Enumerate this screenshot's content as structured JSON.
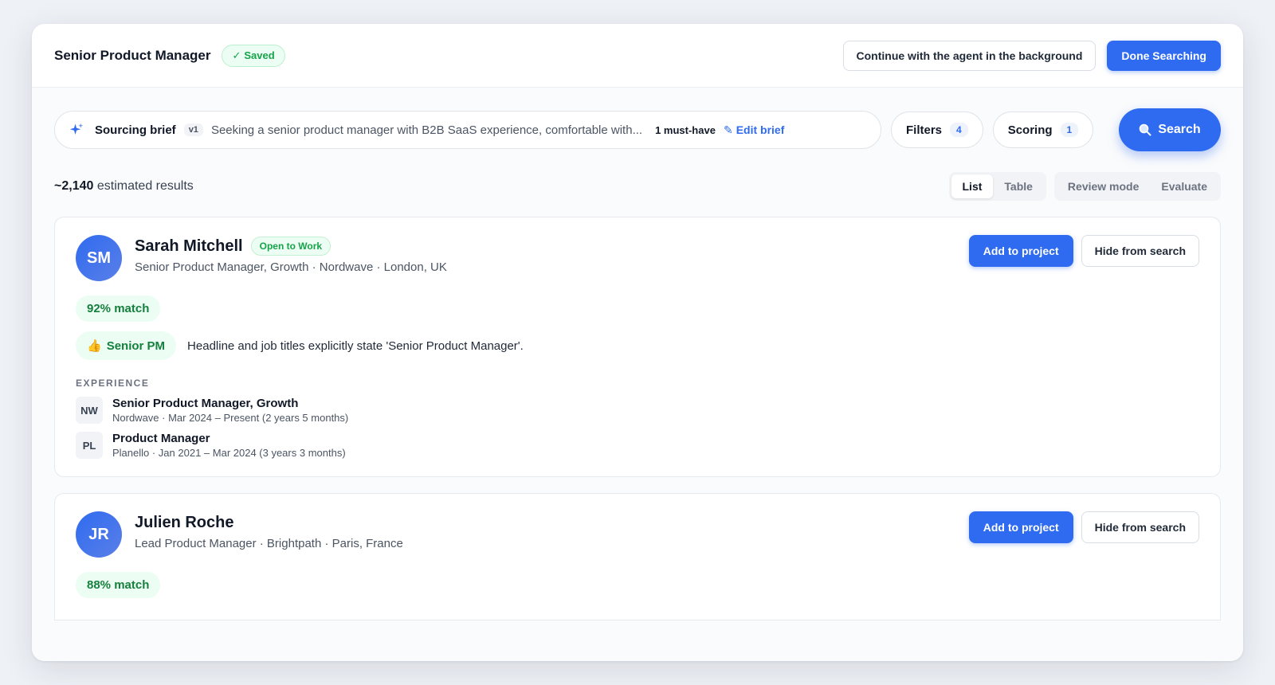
{
  "header": {
    "title": "Senior Product Manager",
    "saved_badge": "Saved",
    "continue_button": "Continue with the agent in the background",
    "done_button": "Done Searching"
  },
  "brief": {
    "label": "Sourcing brief",
    "version": "v1",
    "text": "Seeking a senior product manager with B2B SaaS experience, comfortable with...",
    "must_have": "1 must-have",
    "edit_label": "Edit brief"
  },
  "filters": {
    "label": "Filters",
    "count": "4"
  },
  "scoring": {
    "label": "Scoring",
    "count": "1"
  },
  "search_button": "Search",
  "results": {
    "count": "~2,140",
    "suffix": "estimated results"
  },
  "view_toggle": {
    "list": "List",
    "table": "Table"
  },
  "mode_toggle": {
    "review": "Review mode",
    "evaluate": "Evaluate"
  },
  "accent_color": "#2f6bf0",
  "success_color": "#16a34a",
  "candidates": [
    {
      "initials": "SM",
      "name": "Sarah Mitchell",
      "badge": "Open to Work",
      "subtitle": "Senior Product Manager, Growth · Nordwave · London, UK",
      "add_label": "Add to project",
      "hide_label": "Hide from search",
      "match": "92% match",
      "criterion": {
        "icon": "thumbs-up-icon",
        "emoji": "👍",
        "label": "Senior PM",
        "reason": "Headline and job titles explicitly state 'Senior Product Manager'."
      },
      "experience_label": "EXPERIENCE",
      "experience": [
        {
          "logo": "NW",
          "title": "Senior Product Manager, Growth",
          "detail": "Nordwave · Mar 2024 – Present (2 years 5 months)"
        },
        {
          "logo": "PL",
          "title": "Product Manager",
          "detail": "Planello · Jan 2021 – Mar 2024 (3 years 3 months)"
        }
      ]
    },
    {
      "initials": "JR",
      "name": "Julien Roche",
      "subtitle": "Lead Product Manager · Brightpath · Paris, France",
      "add_label": "Add to project",
      "hide_label": "Hide from search",
      "match": "88% match"
    }
  ]
}
